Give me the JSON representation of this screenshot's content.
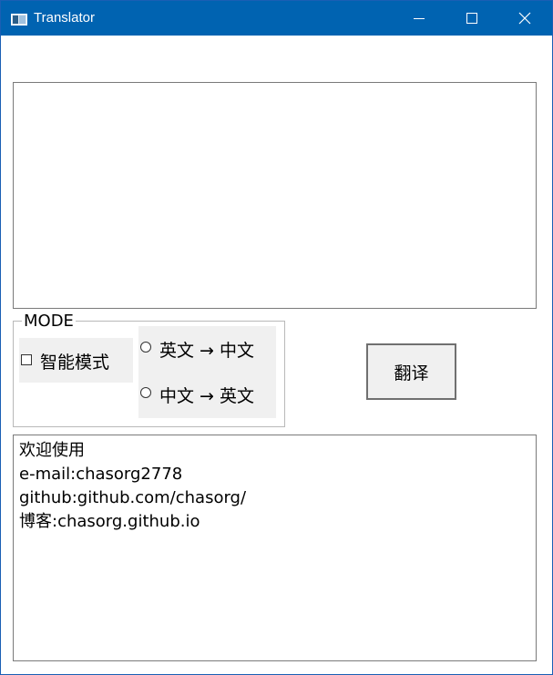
{
  "window": {
    "title": "Translator",
    "icon": "app-window-icon"
  },
  "controls": [
    "minimize-icon",
    "maximize-icon",
    "close-icon"
  ],
  "input": {
    "value": ""
  },
  "mode": {
    "legend": "MODE",
    "smart_mode_label": "智能模式",
    "smart_mode_checked": false,
    "options": [
      "英文 → 中文",
      "中文 → 英文"
    ],
    "selected": null
  },
  "translate_button": "翻译",
  "output": {
    "lines": [
      "欢迎使用",
      "e-mail:chasorg2778",
      "github:github.com/chasorg/",
      "博客:chasorg.github.io"
    ]
  },
  "colors": {
    "titlebar": "#0063b1",
    "panel": "#f0f0f0",
    "border": "#7a7a7a"
  }
}
